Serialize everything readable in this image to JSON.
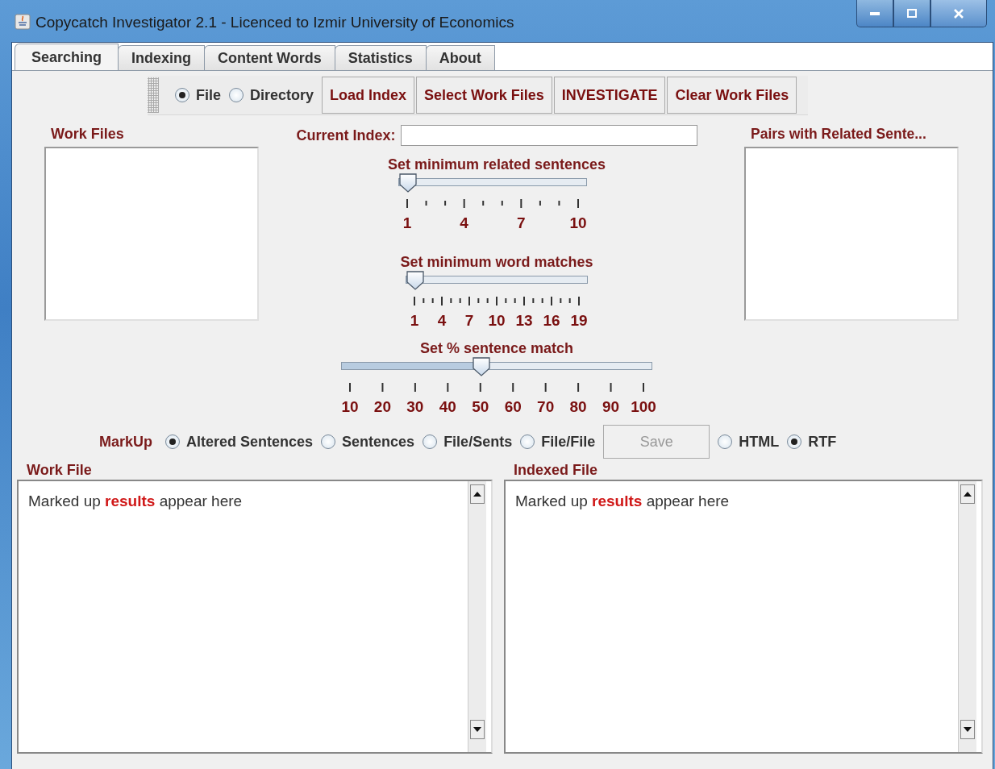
{
  "window": {
    "title": "Copycatch Investigator 2.1 - Licenced to Izmir University of Economics"
  },
  "tabs": [
    {
      "label": "Searching",
      "selected": true
    },
    {
      "label": "Indexing",
      "selected": false
    },
    {
      "label": "Content Words",
      "selected": false
    },
    {
      "label": "Statistics",
      "selected": false
    },
    {
      "label": "About",
      "selected": false
    }
  ],
  "toolbar": [
    {
      "kind": "radio",
      "label": "File",
      "selected": true
    },
    {
      "kind": "radio",
      "label": "Directory",
      "selected": false
    },
    {
      "kind": "button",
      "label": "Load Index"
    },
    {
      "kind": "button",
      "label": "Select Work Files"
    },
    {
      "kind": "button",
      "label": "INVESTIGATE"
    },
    {
      "kind": "button",
      "label": "Clear Work Files"
    }
  ],
  "work_files": {
    "label": "Work Files"
  },
  "current_index": {
    "label": "Current Index:"
  },
  "sliders": [
    {
      "title": "Set minimum related sentences",
      "level": 0,
      "labels": [
        "1",
        "4",
        "7",
        "10"
      ]
    },
    {
      "title": "Set minimum word matches",
      "level": 0,
      "labels": [
        "1",
        "4",
        "7",
        "10",
        "13",
        "16",
        "19"
      ]
    },
    {
      "title": "Set % sentence match",
      "level": 0.444,
      "labels": [
        "10",
        "20",
        "30",
        "40",
        "50",
        "60",
        "70",
        "80",
        "90",
        "100"
      ]
    }
  ],
  "pairs": {
    "label": "Pairs with Related Sente..."
  },
  "markup": {
    "label": "MarkUp",
    "items": [
      {
        "kind": "radio",
        "label": "Altered Sentences",
        "selected": true
      },
      {
        "kind": "radio",
        "label": "Sentences",
        "selected": false
      },
      {
        "kind": "radio",
        "label": "File/Sents",
        "selected": false
      },
      {
        "kind": "radio",
        "label": "File/File",
        "selected": false
      },
      {
        "kind": "button",
        "label": "Save",
        "disabled": true
      },
      {
        "kind": "radio",
        "label": "HTML",
        "selected": false
      },
      {
        "kind": "radio",
        "label": "RTF",
        "selected": true
      }
    ]
  },
  "panes": [
    {
      "label": "Work File",
      "text": "Marked up **results** appear here"
    },
    {
      "label": "Indexed File",
      "text": "Marked up **results** appear here"
    }
  ]
}
